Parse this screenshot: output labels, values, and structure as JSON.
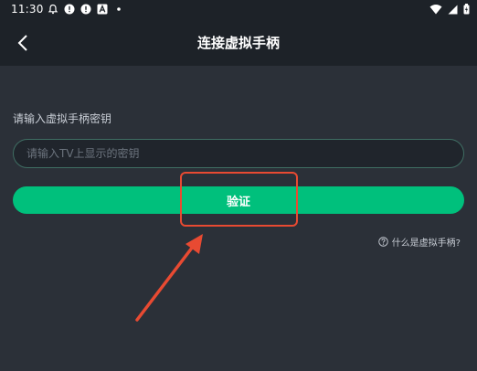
{
  "status_bar": {
    "time": "11:30",
    "left_icons": [
      "bell-icon",
      "alert-icon",
      "alert-icon",
      "a-box-icon",
      "dot-icon"
    ],
    "right_icons": [
      "wifi-icon",
      "signal-icon",
      "battery-icon"
    ]
  },
  "header": {
    "title": "连接虚拟手柄",
    "back_icon": "chevron-left-icon"
  },
  "form": {
    "label": "请输入虚拟手柄密钥",
    "input_placeholder": "请输入TV上显示的密钥",
    "input_value": "",
    "submit_label": "验证"
  },
  "help": {
    "text": "什么是虚拟手柄?",
    "icon": "question-circle-icon"
  },
  "colors": {
    "background": "#2b3038",
    "header_bg": "#1d2228",
    "accent": "#00c07c",
    "annotation": "#e84a32"
  }
}
